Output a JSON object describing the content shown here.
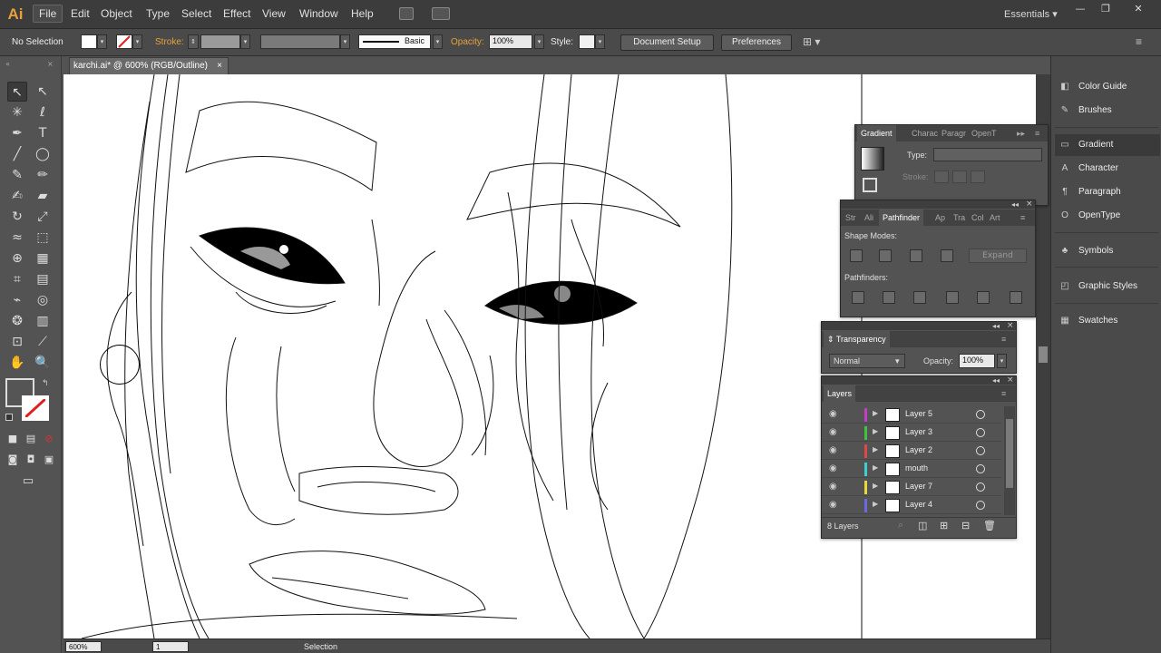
{
  "app": {
    "logo": "Ai"
  },
  "menu": [
    "File",
    "Edit",
    "Object",
    "Type",
    "Select",
    "Effect",
    "View",
    "Window",
    "Help"
  ],
  "workspace": {
    "label": "Essentials",
    "arrow": "▾"
  },
  "window_buttons": {
    "minimize": "—",
    "restore": "❐",
    "close": "✕"
  },
  "controlbar": {
    "selection": "No Selection",
    "stroke_label": "Stroke:",
    "brush_label": "Basic",
    "opacity_label": "Opacity:",
    "opacity_value": "100%",
    "style_label": "Style:",
    "document_setup": "Document Setup",
    "preferences": "Preferences"
  },
  "document": {
    "tab_title": "karchi.ai* @ 600% (RGB/Outline)",
    "close": "×"
  },
  "status": {
    "zoom": "600%",
    "artboard": "1",
    "tool": "Selection"
  },
  "gradient_panel": {
    "tabs": [
      "Gradient",
      "Charac",
      "Paragr",
      "OpenT"
    ],
    "type_label": "Type:",
    "stroke_label": "Stroke:"
  },
  "pathfinder_panel": {
    "tabs": [
      "Str",
      "Ali",
      "Pathfinder",
      "Ap",
      "Tra",
      "Col",
      "Art"
    ],
    "shape_modes_label": "Shape Modes:",
    "pathfinders_label": "Pathfinders:",
    "expand_label": "Expand"
  },
  "transparency_panel": {
    "title": "Transparency",
    "blend_mode": "Normal",
    "opacity_label": "Opacity:",
    "opacity_value": "100%"
  },
  "layers_panel": {
    "title": "Layers",
    "count_label": "8 Layers",
    "layers": [
      {
        "name": "Layer 5",
        "color": "#c43ec4"
      },
      {
        "name": "Layer 3",
        "color": "#3ec43e"
      },
      {
        "name": "Layer 2",
        "color": "#e04848"
      },
      {
        "name": "mouth",
        "color": "#3ed0d0"
      },
      {
        "name": "Layer 7",
        "color": "#e8d83a"
      },
      {
        "name": "Layer 4",
        "color": "#6a6ae0"
      }
    ]
  },
  "dock": {
    "items": [
      {
        "label": "Color Guide",
        "icon": "color-guide-icon"
      },
      {
        "label": "Brushes",
        "icon": "brushes-icon"
      },
      {
        "label": "Gradient",
        "icon": "gradient-icon"
      },
      {
        "label": "Character",
        "icon": "character-icon"
      },
      {
        "label": "Paragraph",
        "icon": "paragraph-icon"
      },
      {
        "label": "OpenType",
        "icon": "opentype-icon"
      },
      {
        "label": "Symbols",
        "icon": "symbols-icon"
      },
      {
        "label": "Graphic Styles",
        "icon": "graphic-styles-icon"
      },
      {
        "label": "Swatches",
        "icon": "swatches-icon"
      }
    ]
  },
  "colors": {
    "accent_orange": "#e8a23a",
    "ui_dark": "#3c3c3c",
    "ui_mid": "#535353"
  }
}
